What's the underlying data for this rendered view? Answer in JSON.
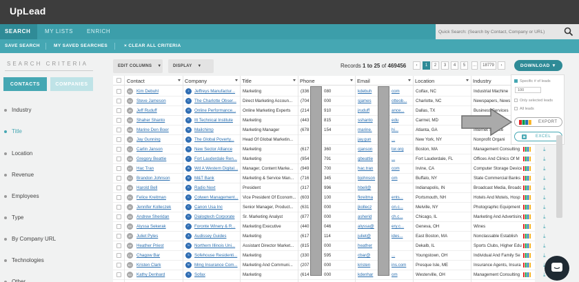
{
  "app": {
    "logo": "UpLead"
  },
  "nav": {
    "tabs": [
      {
        "label": "SEARCH",
        "active": true
      },
      {
        "label": "MY LISTS"
      },
      {
        "label": "ENRICH"
      }
    ],
    "quick_search_placeholder": "Quick Search: (Search by Contact, Company or URL)"
  },
  "subnav": {
    "save_search": "SAVE SEARCH",
    "my_saved": "MY SAVED SEARCHES",
    "clear": "× CLEAR ALL CRITERIA"
  },
  "sidebar": {
    "title": "SEARCH CRITERIA",
    "contacts_btn": "CONTACTS",
    "companies_btn": "COMPANIES",
    "filters": [
      "Industry",
      "Title",
      "Location",
      "Revenue",
      "Employees",
      "Type",
      "By Company URL",
      "Technologies",
      "Other"
    ],
    "active_filter": "Title"
  },
  "toolbar": {
    "edit_columns": "EDIT COLUMNS",
    "display": "DISPLAY",
    "records_prefix": "Records",
    "records_range": "1 to 25",
    "records_of": "of",
    "records_total": "469456",
    "pages": [
      "‹",
      "1",
      "2",
      "3",
      "4",
      "5",
      "...",
      "18779",
      "›"
    ],
    "download": "DOWNLOAD"
  },
  "table": {
    "headers": [
      "Contact",
      "Company",
      "Title",
      "Phone",
      "Email",
      "Location",
      "Industry"
    ],
    "rows": [
      {
        "initials": "KD",
        "contact": "Kim Debuhl",
        "clogo": "J",
        "company": "Jeffreys Manufactur...",
        "title": "Marketing",
        "phone": "(336",
        "phone_end": "080",
        "email": "kdebuh",
        "email_end": "com",
        "location": "Colfax, NC",
        "industry": "Industrial Machine"
      },
      {
        "initials": "SJ",
        "contact": "Steve Jameson",
        "clogo": "C",
        "company": "The Charlotte Obser...",
        "title": "Direct Marketing Accoun...",
        "phone": "(704",
        "phone_end": "000",
        "email": "sjames",
        "email_end": "otteob...",
        "location": "Charlotte, NC",
        "industry": "Newspapers, News"
      },
      {
        "initials": "JR",
        "contact": "Jeff Ruduff",
        "clogo": "O",
        "company": "Online Performance...",
        "title": "Online Marketing Experts",
        "phone": "(214",
        "phone_end": "910",
        "email": "jruduff",
        "email_end": "ance...",
        "location": "Dallas, TX",
        "industry": "Business Services"
      },
      {
        "initials": "SS",
        "contact": "Shaher Shanto",
        "clogo": "IT",
        "company": "Itt Technical Institute",
        "title": "Marketing",
        "phone": "(443",
        "phone_end": "815",
        "email": "sshanto",
        "email_end": "edu",
        "location": "Carmel, MD",
        "industry": "Education"
      },
      {
        "initials": "MB",
        "contact": "Marine Den Boer",
        "clogo": "M",
        "company": "Mailchimp",
        "title": "Marketing Manager",
        "phone": "(678",
        "phone_end": "154",
        "email": "marine.",
        "email_end": "hi...",
        "location": "Atlanta, GA",
        "industry": "Internet Service"
      },
      {
        "initials": "JG",
        "contact": "Jay Gunning",
        "clogo": "G",
        "company": "The Global Poverty...",
        "title": "Head Of Global Marketin...",
        "phone": "",
        "phone_end": "",
        "email": "jay.gun",
        "email_end": "...",
        "location": "New York, NY",
        "industry": "Nonprofit Organi"
      },
      {
        "initials": "CJ",
        "contact": "Carlin Janson",
        "clogo": "N",
        "company": "New Sector Alliance",
        "title": "Marketing",
        "phone": "(617",
        "phone_end": "360",
        "email": "cjanson",
        "email_end": "tor.org",
        "location": "Boston, MA",
        "industry": "Management Consulting"
      },
      {
        "initials": "GB",
        "contact": "Gregory Beattie",
        "clogo": "F",
        "company": "Fort Lauderdale Ren...",
        "title": "Marketing",
        "phone": "(954",
        "phone_end": "791",
        "email": "gbeattie",
        "email_end": "...",
        "location": "Fort Lauderdale, FL",
        "industry": "Offices And Clinics Of M"
      },
      {
        "initials": "HT",
        "contact": "Hac Tran",
        "clogo": "W",
        "company": "Wd A Western Digital...",
        "title": "Manager, Content Marke...",
        "phone": "(949",
        "phone_end": "700",
        "email": "hac.tran",
        "email_end": "com",
        "location": "Irvine, CA",
        "industry": "Computer Storage Device"
      },
      {
        "initials": "BJ",
        "contact": "Brandon Johnson",
        "clogo": "M",
        "company": "M&T Bank",
        "title": "Marketing & Service Man...",
        "phone": "(716",
        "phone_end": "345",
        "email": "bjohnson",
        "email_end": "om",
        "location": "Buffalo, NY",
        "industry": "State Commercial Banks"
      },
      {
        "initials": "HB",
        "contact": "Harold Bell",
        "clogo": "R",
        "company": "Radio Next",
        "title": "President",
        "phone": "(317",
        "phone_end": "996",
        "email": "hbell@",
        "email_end": "",
        "location": "Indianapolis, IN",
        "industry": "Broadcast Media, Broadc"
      },
      {
        "initials": "FK",
        "contact": "Felice Kreitman",
        "clogo": "C",
        "company": "Colwen Management...",
        "title": "Vice President Of Econom...",
        "phone": "(603",
        "phone_end": "100",
        "email": "fkreitma",
        "email_end": "ents...",
        "location": "Portsmouth, NH",
        "industry": "Hotels And Motels, Hosp"
      },
      {
        "initials": "JK",
        "contact": "Jennifer Kolleczek",
        "clogo": "C",
        "company": "Canon Usa Inc",
        "title": "Senior Manager, Product...",
        "phone": "(631",
        "phone_end": "000",
        "email": "jkollecz",
        "email_end": "on.c...",
        "location": "Melville, NY",
        "industry": "Photographic Equipment"
      },
      {
        "initials": "AS",
        "contact": "Andrew Sheridan",
        "clogo": "D",
        "company": "Dialogtech Corporate",
        "title": "Sr. Marketing Analyst",
        "phone": "(877",
        "phone_end": "000",
        "email": "asherid",
        "email_end": "ch.c...",
        "location": "Chicago, IL",
        "industry": "Marketing And Advertising"
      },
      {
        "initials": "AS",
        "contact": "Alyssa Sekerak",
        "clogo": "F",
        "company": "Foronte Winery & R...",
        "title": "Marketing Executive",
        "phone": "(440",
        "phone_end": "046",
        "email": "alyssa@",
        "email_end": "ery.c...",
        "location": "Geneva, OH",
        "industry": "Wines"
      },
      {
        "initials": "JP",
        "contact": "Juliet Pyles",
        "clogo": "A",
        "company": "Audissey Guides",
        "title": "Marketing",
        "phone": "(617",
        "phone_end": "114",
        "email": "juliet@",
        "email_end": "ides...",
        "location": "East Boston, MA",
        "industry": "Nonclassable Establish"
      },
      {
        "initials": "HP",
        "contact": "Heather Priest",
        "clogo": "N",
        "company": "Northern Illinois Uni...",
        "title": "Assistant Director Market...",
        "phone": "(815",
        "phone_end": "000",
        "email": "heather",
        "email_end": "",
        "location": "Dekalb, IL",
        "industry": "Sports Clubs, Higher Edu"
      },
      {
        "initials": "CB",
        "contact": "Chagow Bar",
        "clogo": "S",
        "company": "Sofehouse Residenti...",
        "title": "Marketing",
        "phone": "(330",
        "phone_end": "595",
        "email": "cbar@",
        "email_end": "...",
        "location": "Youngstown, OH",
        "industry": "Individual And Family Se"
      },
      {
        "initials": "KC",
        "contact": "Kristen Clark",
        "clogo": "M",
        "company": "Mmg Insurance Com...",
        "title": "Marketing And Communi...",
        "phone": "(207",
        "phone_end": "000",
        "email": "kristen",
        "email_end": "ins.com",
        "location": "Presque Isle, ME",
        "industry": "Insurance Agents, Insura"
      },
      {
        "initials": "KD",
        "contact": "Kathy Denhard",
        "clogo": "S",
        "company": "Sofax",
        "title": "Marketing",
        "phone": "(614",
        "phone_end": "000",
        "email": "kdenhar",
        "email_end": "om",
        "location": "Westerville, OH",
        "industry": "Management Consulting"
      }
    ]
  },
  "download_panel": {
    "specific": "Specific # of leads",
    "specific_value": "100",
    "selected": "Only selected leads",
    "all": "All leads",
    "export": "EXPORT",
    "excel": "EXCEL"
  },
  "colors": {
    "teal": "#45a7b3",
    "teal_dark": "#2f8b97",
    "topbar": "#3d3d3d"
  }
}
